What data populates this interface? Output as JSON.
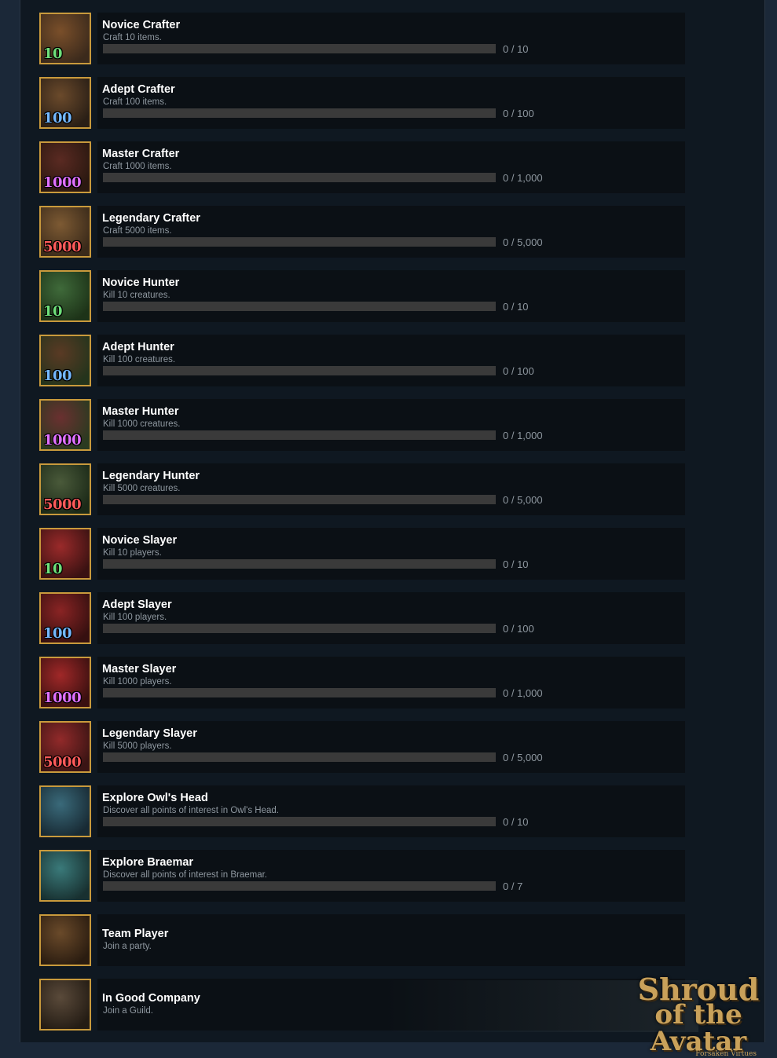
{
  "achievements": [
    {
      "title": "Novice Crafter",
      "desc": "Craft 10 items.",
      "progress": "0 / 10",
      "fraction": 0,
      "badge": "10",
      "badge_color": "#6ee07a",
      "icon": "crafting-tools-icon",
      "theme": [
        "#7a4f2a",
        "#3b2a1c"
      ],
      "has_bar": true
    },
    {
      "title": "Adept Crafter",
      "desc": "Craft 100 items.",
      "progress": "0 / 100",
      "fraction": 0,
      "badge": "100",
      "badge_color": "#74b8ff",
      "icon": "crafting-tools-icon",
      "theme": [
        "#6b4a2b",
        "#2a1f16"
      ],
      "has_bar": true
    },
    {
      "title": "Master Crafter",
      "desc": "Craft 1000 items.",
      "progress": "0 / 1,000",
      "fraction": 0,
      "badge": "1000",
      "badge_color": "#e070ff",
      "icon": "crafting-tools-icon",
      "theme": [
        "#5a2a22",
        "#2a1810"
      ],
      "has_bar": true
    },
    {
      "title": "Legendary Crafter",
      "desc": "Craft 5000 items.",
      "progress": "0 / 5,000",
      "fraction": 0,
      "badge": "5000",
      "badge_color": "#ff5a5a",
      "icon": "crafting-tools-icon",
      "theme": [
        "#7d5a33",
        "#3a2a1a"
      ],
      "has_bar": true
    },
    {
      "title": "Novice Hunter",
      "desc": "Kill 10 creatures.",
      "progress": "0 / 10",
      "fraction": 0,
      "badge": "10",
      "badge_color": "#6ee07a",
      "icon": "hunter-portrait-icon",
      "theme": [
        "#3f6a3a",
        "#1d3318"
      ],
      "has_bar": true
    },
    {
      "title": "Adept Hunter",
      "desc": "Kill 100 creatures.",
      "progress": "0 / 100",
      "fraction": 0,
      "badge": "100",
      "badge_color": "#74b8ff",
      "icon": "hunter-portrait-icon",
      "theme": [
        "#5a3a24",
        "#24341c"
      ],
      "has_bar": true
    },
    {
      "title": "Master Hunter",
      "desc": "Kill 1000 creatures.",
      "progress": "0 / 1,000",
      "fraction": 0,
      "badge": "1000",
      "badge_color": "#e070ff",
      "icon": "hunter-portrait-icon",
      "theme": [
        "#6a3030",
        "#2a3a20"
      ],
      "has_bar": true
    },
    {
      "title": "Legendary Hunter",
      "desc": "Kill 5000 creatures.",
      "progress": "0 / 5,000",
      "fraction": 0,
      "badge": "5000",
      "badge_color": "#ff5a5a",
      "icon": "hunter-portrait-icon",
      "theme": [
        "#4a5a3a",
        "#1c2a18"
      ],
      "has_bar": true
    },
    {
      "title": "Novice Slayer",
      "desc": "Kill 10 players.",
      "progress": "0 / 10",
      "fraction": 0,
      "badge": "10",
      "badge_color": "#6ee07a",
      "icon": "slayer-axe-icon",
      "theme": [
        "#9a2a2a",
        "#3a1212"
      ],
      "has_bar": true
    },
    {
      "title": "Adept Slayer",
      "desc": "Kill 100 players.",
      "progress": "0 / 100",
      "fraction": 0,
      "badge": "100",
      "badge_color": "#74b8ff",
      "icon": "slayer-axe-icon",
      "theme": [
        "#8a2424",
        "#361010"
      ],
      "has_bar": true
    },
    {
      "title": "Master Slayer",
      "desc": "Kill 1000 players.",
      "progress": "0 / 1,000",
      "fraction": 0,
      "badge": "1000",
      "badge_color": "#e070ff",
      "icon": "slayer-axe-icon",
      "theme": [
        "#a02828",
        "#3a1010"
      ],
      "has_bar": true
    },
    {
      "title": "Legendary Slayer",
      "desc": "Kill 5000 players.",
      "progress": "0 / 5,000",
      "fraction": 0,
      "badge": "5000",
      "badge_color": "#ff5a5a",
      "icon": "slayer-axe-icon",
      "theme": [
        "#922a2a",
        "#3a1414"
      ],
      "has_bar": true
    },
    {
      "title": "Explore Owl's Head",
      "desc": "Discover all points of interest in Owl's Head.",
      "progress": "0 / 10",
      "fraction": 0,
      "badge": "",
      "badge_color": "#ffffff",
      "icon": "owl-shield-icon",
      "theme": [
        "#3a6a7a",
        "#182a34"
      ],
      "has_bar": true
    },
    {
      "title": "Explore Braemar",
      "desc": "Discover all points of interest in Braemar.",
      "progress": "0 / 7",
      "fraction": 0,
      "badge": "",
      "badge_color": "#ffffff",
      "icon": "horn-shield-icon",
      "theme": [
        "#3a7a7a",
        "#183030"
      ],
      "has_bar": true
    },
    {
      "title": "Team Player",
      "desc": "Join a party.",
      "progress": "",
      "fraction": 0,
      "badge": "",
      "badge_color": "#ffffff",
      "icon": "party-group-icon",
      "theme": [
        "#6a4a2a",
        "#2a1c10"
      ],
      "has_bar": false
    },
    {
      "title": "In Good Company",
      "desc": "Join a Guild.",
      "progress": "",
      "fraction": 0,
      "badge": "",
      "badge_color": "#ffffff",
      "icon": "guild-group-icon",
      "theme": [
        "#5a4a3a",
        "#241c14"
      ],
      "has_bar": false
    }
  ],
  "logo": {
    "line1": "Shroud",
    "line2": "of the Avatar",
    "tagline": "Forsaken Virtues"
  },
  "colors": {
    "icon_border": "#c99a3c",
    "bar_bg": "#3a3a3a",
    "card_bg": "#0b1015",
    "page_bg": "#1b2838"
  }
}
